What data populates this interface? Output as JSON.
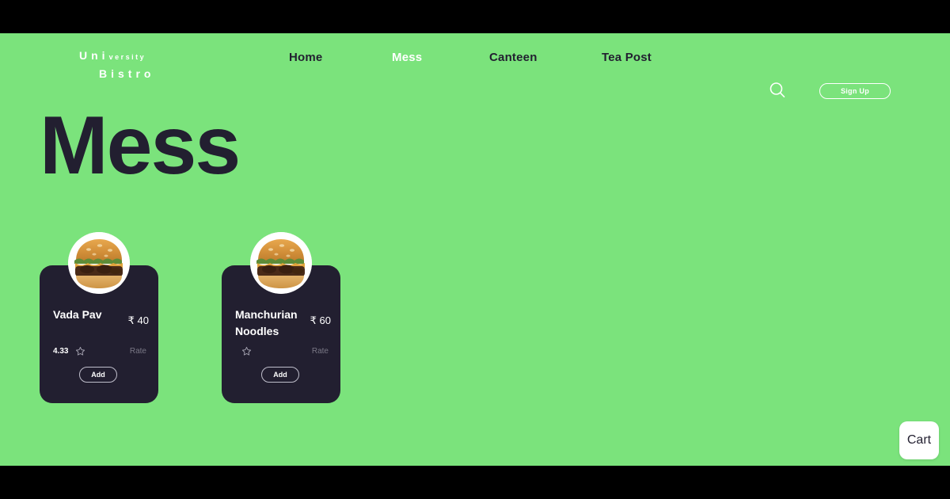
{
  "brand": {
    "line1_big": "Uni",
    "line1_small": "versity",
    "line2": "Bistro"
  },
  "nav": {
    "items": [
      {
        "label": "Home",
        "active": false
      },
      {
        "label": "Mess",
        "active": true
      },
      {
        "label": "Canteen",
        "active": false
      },
      {
        "label": "Tea Post",
        "active": false
      }
    ],
    "search_icon": "search-icon",
    "signup_label": "Sign Up"
  },
  "hero": {
    "title": "Mess"
  },
  "menu": {
    "items": [
      {
        "name": "Vada Pav",
        "price": "₹ 40",
        "rating": "4.33",
        "has_rating": true,
        "rate_label": "Rate",
        "add_label": "Add",
        "star_icon": "star-outline-icon",
        "image": "burger-photo"
      },
      {
        "name": "Manchurian Noodles",
        "price": "₹ 60",
        "rating": "",
        "has_rating": false,
        "rate_label": "Rate",
        "add_label": "Add",
        "star_icon": "star-outline-icon",
        "image": "burger-photo"
      }
    ]
  },
  "cart": {
    "label": "Cart"
  },
  "colors": {
    "background_green": "#7BE37C",
    "card_dark": "#221F30",
    "text_white": "#FFFFFF",
    "muted_gray": "#7A7886",
    "letterbox_black": "#000000"
  }
}
